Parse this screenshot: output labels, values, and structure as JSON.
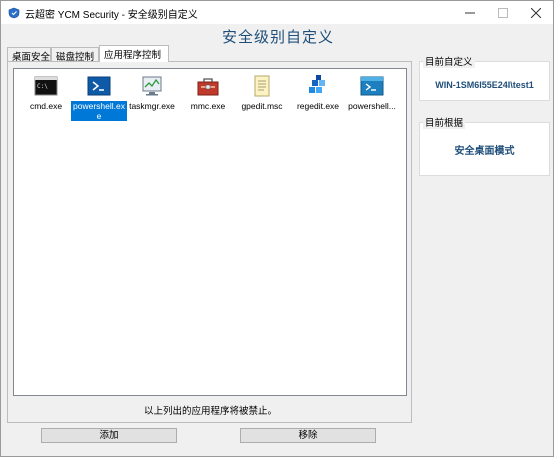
{
  "window": {
    "title": "云超密 YCM Security - 安全级别自定义",
    "min_icon": "minimize-icon",
    "max_icon": "maximize-icon",
    "close_icon": "close-icon"
  },
  "header": {
    "title": "安全级别自定义"
  },
  "tabs": [
    {
      "label": "桌面安全",
      "active": false
    },
    {
      "label": "磁盘控制",
      "active": false
    },
    {
      "label": "应用程序控制",
      "active": true
    }
  ],
  "apps": [
    {
      "label": "cmd.exe",
      "icon": "cmd-icon",
      "selected": false
    },
    {
      "label": "powershell.exe",
      "icon": "powershell-icon",
      "selected": true
    },
    {
      "label": "taskmgr.exe",
      "icon": "taskmgr-icon",
      "selected": false
    },
    {
      "label": "mmc.exe",
      "icon": "mmc-icon",
      "selected": false
    },
    {
      "label": "gpedit.msc",
      "icon": "gpedit-icon",
      "selected": false
    },
    {
      "label": "regedit.exe",
      "icon": "regedit-icon",
      "selected": false
    },
    {
      "label": "powershell...",
      "icon": "powershell-ise-icon",
      "selected": false
    }
  ],
  "notice": "以上列出的应用程序将被禁止。",
  "buttons": {
    "add": "添加",
    "remove": "移除"
  },
  "current_custom": {
    "label": "目前自定义",
    "value": "WIN-1SM6I55E24I\\test1"
  },
  "current_basis": {
    "label": "目前根据",
    "value": "安全桌面模式"
  },
  "colors": {
    "accent": "#1f4e79",
    "selection": "#0078d7"
  }
}
